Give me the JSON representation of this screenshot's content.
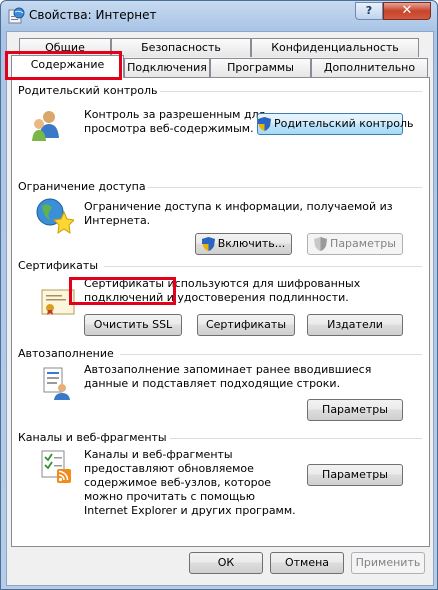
{
  "window": {
    "title": "Свойства: Интернет",
    "help_label": "?",
    "close_label": "✕"
  },
  "tabs_back": [
    {
      "label": "Общие"
    },
    {
      "label": "Безопасность"
    },
    {
      "label": "Конфиденциальность"
    }
  ],
  "tabs_front": [
    {
      "label": "Содержание",
      "active": true
    },
    {
      "label": "Подключения"
    },
    {
      "label": "Программы"
    },
    {
      "label": "Дополнительно"
    }
  ],
  "parental": {
    "title": "Родительский контроль",
    "desc": [
      "Контроль за разрешенным для",
      "просмотра веб-содержимым."
    ],
    "button": "Родительский контроль"
  },
  "access": {
    "title": "Ограничение доступа",
    "desc": [
      "Ограничение доступа к информации, получаемой из",
      "Интернета."
    ],
    "enable_button": "Включить...",
    "params_button": "Параметры"
  },
  "certs": {
    "title": "Сертификаты",
    "desc": [
      "Сертификаты используются для шифрованных",
      "подключений и удостоверения подлинности."
    ],
    "clear_ssl_button": "Очистить SSL",
    "certs_button": "Сертификаты",
    "publishers_button": "Издатели"
  },
  "autocomplete": {
    "title": "Автозаполнение",
    "desc": [
      "Автозаполнение запоминает ранее вводившиеся",
      "данные и подставляет подходящие строки."
    ],
    "params_button": "Параметры"
  },
  "feeds": {
    "title": "Каналы и веб-фрагменты",
    "desc": [
      "Каналы и веб-фрагменты",
      "предоставляют обновляемое",
      "содержимое веб-узлов, которое",
      "можно прочитать с помощью",
      "Internet Explorer и других программ."
    ],
    "params_button": "Параметры"
  },
  "footer": {
    "ok": "ОК",
    "cancel": "Отмена",
    "apply": "Применить"
  }
}
